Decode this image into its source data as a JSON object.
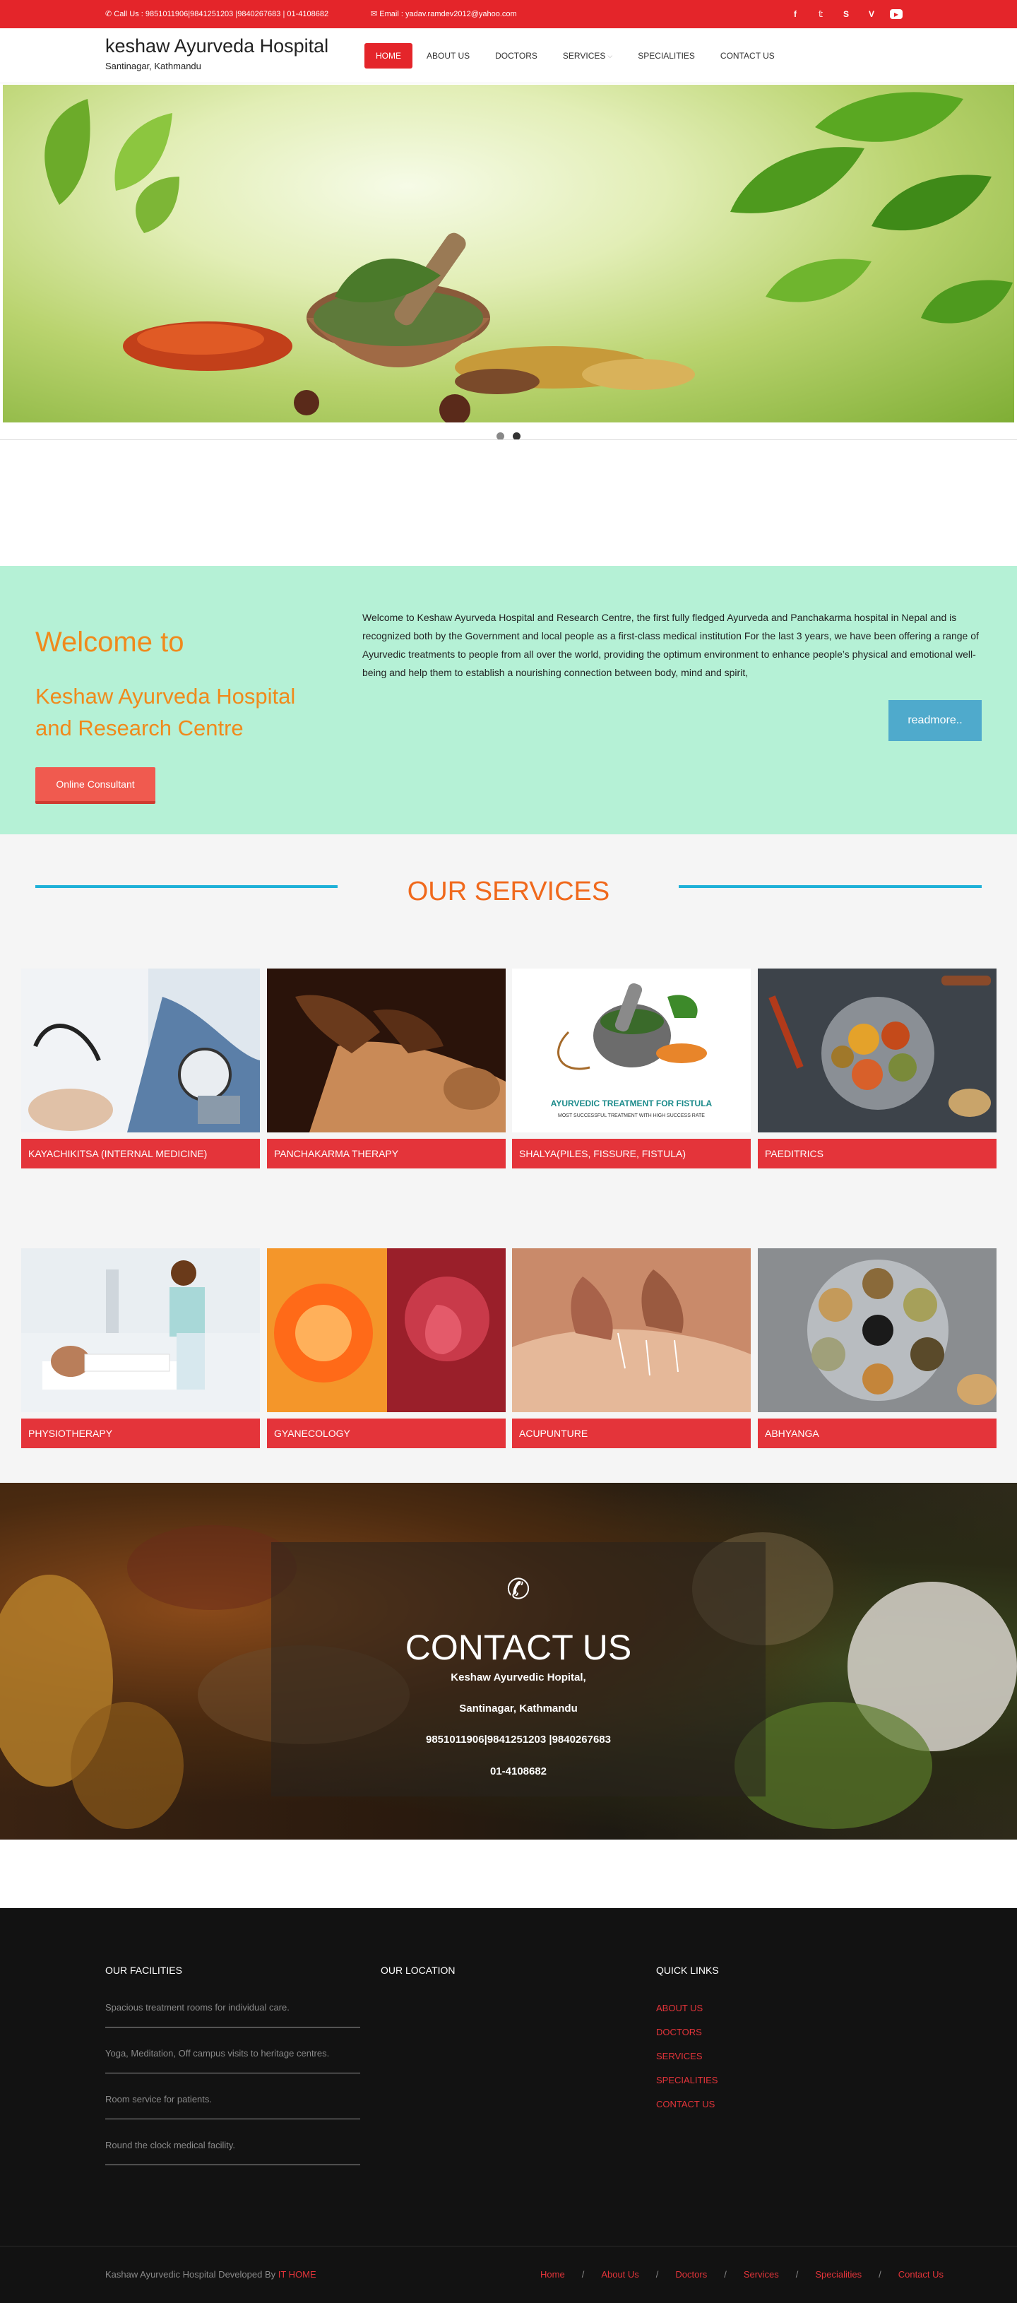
{
  "topbar": {
    "call": "Call Us : 9851011906|9841251203 |9840267683 | 01-4108682",
    "email_label": "Email :",
    "email": "yadav.ramdev2012@yahoo.com",
    "social": [
      "f",
      "t",
      "s",
      "v",
      "yt"
    ]
  },
  "header": {
    "title": "keshaw Ayurveda Hospital",
    "subtitle": "Santinagar, Kathmandu",
    "nav": [
      "HOME",
      "ABOUT US",
      "DOCTORS",
      "SERVICES",
      "SPECIALITIES",
      "CONTACT US"
    ]
  },
  "welcome": {
    "h1": "Welcome to",
    "h2": "Keshaw Ayurveda Hospital and Research Centre",
    "button": "Online Consultant",
    "text": "Welcome to Keshaw Ayurveda Hospital and Research Centre, the first fully fledged Ayurveda and Panchakarma hospital in Nepal and is recognized both by the Government and local people as a first-class medical institution For the last 3 years, we have been offering a range of Ayurvedic treatments to people from all over the world, providing the optimum environment to enhance people’s physical and emotional well-being and help them to establish a nourishing connection between body, mind and spirit,",
    "readmore": "readmore.."
  },
  "services": {
    "title": "OUR SERVICES",
    "items": [
      {
        "label": "KAYACHIKITSA (INTERNAL MEDICINE)"
      },
      {
        "label": "PANCHAKARMA THERAPY"
      },
      {
        "label": "SHALYA(PILES, FISSURE, FISTULA)"
      },
      {
        "label": "PAEDITRICS"
      },
      {
        "label": "PHYSIOTHERAPY"
      },
      {
        "label": "GYANECOLOGY"
      },
      {
        "label": "ACUPUNTURE"
      },
      {
        "label": "ABHYANGA"
      }
    ],
    "fistula_caption": "AYURVEDIC TREATMENT FOR FISTULA",
    "fistula_sub": "MOST SUCCESSFUL TREATMENT WITH HIGH SUCCESS RATE"
  },
  "contact": {
    "title": "CONTACT US",
    "line1": "Keshaw Ayurvedic Hopital,",
    "line2": "Santinagar, Kathmandu",
    "line3": "9851011906|9841251203 |9840267683",
    "line4": "01-4108682"
  },
  "footer": {
    "facilities_title": "OUR FACILITIES",
    "location_title": "OUR LOCATION",
    "links_title": "QUICK LINKS",
    "facilities": [
      "Spacious treatment rooms for individual care.",
      "Yoga, Meditation, Off campus visits to heritage centres.",
      "Room service for patients.",
      "Round the clock medical facility."
    ],
    "links": [
      "ABOUT US",
      "DOCTORS",
      "SERVICES",
      "SPECIALITIES",
      "CONTACT US"
    ],
    "credit_prefix": "Kashaw Ayurvedic Hospital Developed By",
    "credit_link": "IT HOME",
    "bottom_links": [
      "Home",
      "About Us",
      "Doctors",
      "Services",
      "Specialities",
      "Contact Us"
    ]
  },
  "colors": {
    "brand_red": "#e4252a",
    "accent_orange": "#f08a1c",
    "mint": "#b5f1d6",
    "blue": "#4faacc"
  }
}
